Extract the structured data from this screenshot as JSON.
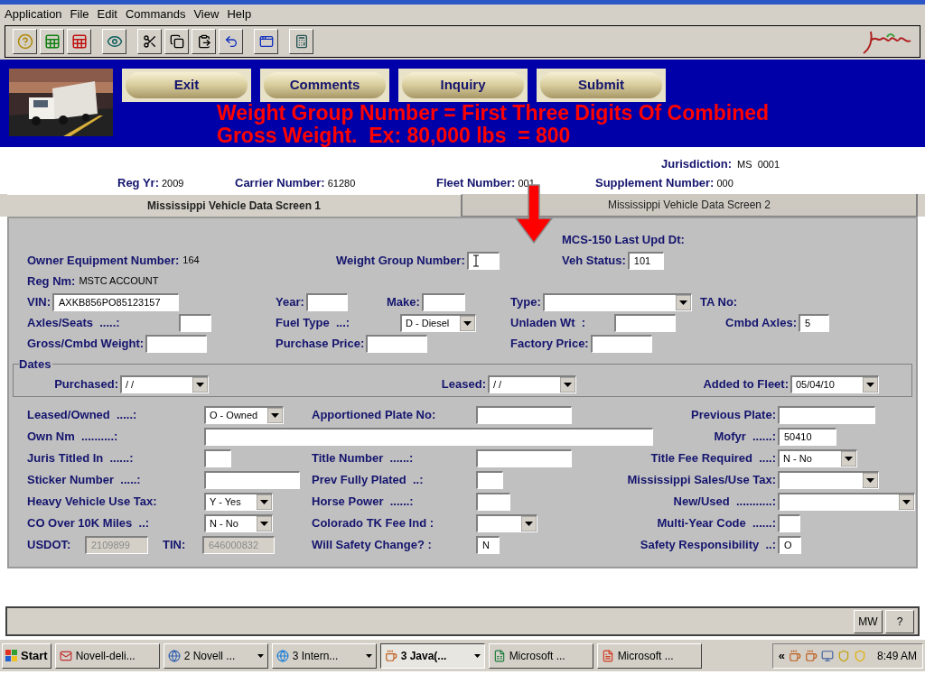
{
  "menu": [
    "Application",
    "File",
    "Edit",
    "Commands",
    "View",
    "Help"
  ],
  "header_buttons": [
    "Exit",
    "Comments",
    "Inquiry",
    "Submit"
  ],
  "note_lines": [
    "Weight Group Number = First Three Digits Of Combined",
    "Gross Weight.  Ex: 80,000 lbs  = 800"
  ],
  "jurisdiction": {
    "label": "Jurisdiction:",
    "value": "MS  0001"
  },
  "header_info": [
    {
      "label": "Reg Yr:",
      "value": "2009"
    },
    {
      "label": "Carrier Number:",
      "value": "61280"
    },
    {
      "label": "Fleet Number:",
      "value": "001"
    },
    {
      "label": "Supplement Number:",
      "value": "000"
    }
  ],
  "tabs": [
    {
      "label": "Mississippi Vehicle Data Screen 1",
      "selected": true
    },
    {
      "label": "Mississippi Vehicle Data Screen 2",
      "selected": false
    }
  ],
  "top_rows": [
    [
      {
        "kind": "static",
        "label": "MCS-150 Last Upd Dt:"
      }
    ],
    [
      {
        "kind": "static",
        "label": "Owner Equipment Number:",
        "value": "164"
      },
      {
        "kind": "input",
        "label": "Weight Group Number:",
        "focused": true
      },
      {
        "kind": "input",
        "label": "Veh Status:",
        "value": "101"
      }
    ],
    [
      {
        "kind": "static",
        "label": "Reg Nm:",
        "value": "MSTC ACCOUNT"
      }
    ],
    [
      {
        "kind": "input",
        "label": "VIN:",
        "value": "AXKB856PO85123157"
      },
      {
        "kind": "input",
        "label": "Year:"
      },
      {
        "kind": "input",
        "label": "Make:"
      },
      {
        "kind": "select",
        "label": "Type:"
      },
      {
        "kind": "static",
        "label": "TA No:"
      }
    ],
    [
      {
        "kind": "input",
        "label": "Axles/Seats  .....:"
      },
      {
        "kind": "select",
        "label": "Fuel Type  ...:",
        "value": "D - Diesel"
      },
      {
        "kind": "input",
        "label": "Unladen Wt  :"
      },
      {
        "kind": "input",
        "label": "Cmbd Axles:",
        "value": "5"
      }
    ],
    [
      {
        "kind": "input",
        "label": "Gross/Cmbd Weight:"
      },
      {
        "kind": "input",
        "label": "Purchase Price:"
      },
      {
        "kind": "input",
        "label": "Factory Price:"
      }
    ]
  ],
  "dates": {
    "title": "Dates",
    "fields": [
      {
        "kind": "select",
        "label": "Purchased:",
        "value": "/ /"
      },
      {
        "kind": "select",
        "label": "Leased:",
        "value": "/ /"
      },
      {
        "kind": "select",
        "label": "Added to Fleet:",
        "value": "05/04/10"
      }
    ]
  },
  "lower_rows": [
    [
      {
        "kind": "select",
        "label": "Leased/Owned  .....:",
        "value": "O - Owned"
      },
      {
        "kind": "input",
        "label": "Apportioned Plate No:"
      },
      {
        "kind": "input",
        "label": "Previous Plate:"
      }
    ],
    [
      {
        "kind": "input",
        "label": "Own Nm  ..........:"
      },
      {
        "kind": "input",
        "label": "Mofyr  ......:",
        "value": "50410"
      }
    ],
    [
      {
        "kind": "input",
        "label": "Juris Titled In  ......:"
      },
      {
        "kind": "input",
        "label": "Title Number  ......:"
      },
      {
        "kind": "select",
        "label": "Title Fee Required  ....:",
        "value": "N - No"
      }
    ],
    [
      {
        "kind": "input",
        "label": "Sticker Number  .....:"
      },
      {
        "kind": "input",
        "label": "Prev Fully Plated  ..:"
      },
      {
        "kind": "select",
        "label": "Mississippi Sales/Use Tax:"
      }
    ],
    [
      {
        "kind": "select",
        "label": "Heavy Vehicle Use Tax:",
        "value": "Y - Yes"
      },
      {
        "kind": "input",
        "label": "Horse Power  ......:"
      },
      {
        "kind": "select",
        "label": "New/Used  ...........:"
      }
    ],
    [
      {
        "kind": "select",
        "label": "CO Over 10K Miles  ..:",
        "value": "N - No"
      },
      {
        "kind": "select",
        "label": "Colorado TK Fee Ind :"
      },
      {
        "kind": "input",
        "label": "Multi-Year Code  ......:"
      }
    ],
    [
      {
        "kind": "readonly",
        "label": "USDOT:",
        "value": "2109899"
      },
      {
        "kind": "readonly",
        "label": "TIN:",
        "value": "646000832"
      },
      {
        "kind": "input",
        "label": "Will Safety Change? :",
        "value": "N"
      },
      {
        "kind": "input",
        "label": "Safety Responsibility  ..:",
        "value": "O"
      }
    ]
  ],
  "status_buttons": [
    "MW",
    "?"
  ],
  "taskbar": {
    "start": "Start",
    "items": [
      {
        "label": "Novell-deli...",
        "grouped": false,
        "selected": false
      },
      {
        "label": "2 Novell ...",
        "grouped": true,
        "selected": false
      },
      {
        "label": "3 Intern...",
        "grouped": true,
        "selected": false
      },
      {
        "label": "3 Java(...",
        "grouped": true,
        "selected": true
      },
      {
        "label": "Microsoft ...",
        "grouped": false,
        "selected": false
      },
      {
        "label": "Microsoft ...",
        "grouped": false,
        "selected": false
      }
    ],
    "tray_expand": "«",
    "clock": "8:49 AM"
  }
}
